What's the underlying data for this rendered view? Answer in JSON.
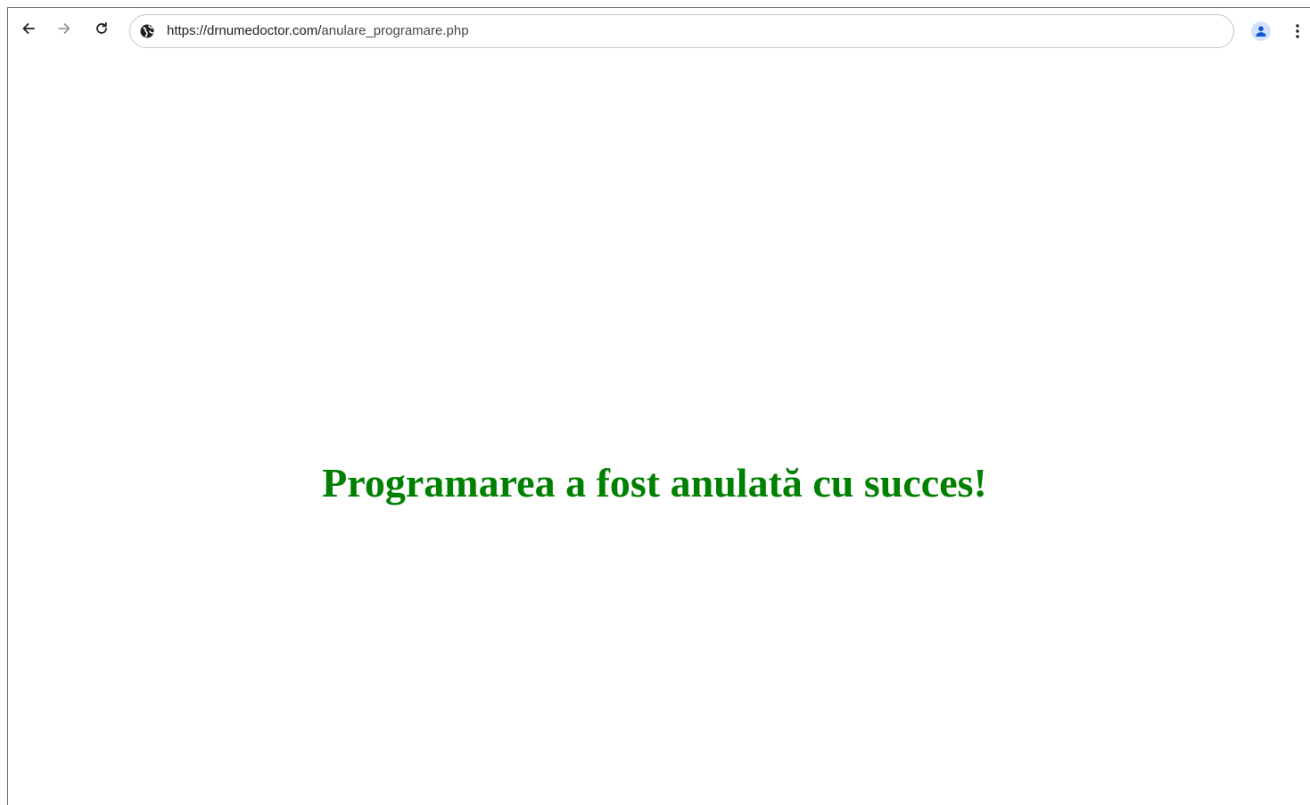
{
  "browser": {
    "url_host": "https://drnumedoctor.com/",
    "url_path": "anulare_programare.php",
    "icons": {
      "back": "arrow-left-icon",
      "forward": "arrow-right-icon",
      "reload": "reload-icon",
      "site": "globe-icon",
      "profile": "person-icon",
      "menu": "kebab-menu-icon"
    },
    "colors": {
      "accent": "#0b57d0",
      "profile_bg": "#d3e3fd"
    }
  },
  "page": {
    "message": "Programarea a fost anulată cu succes!",
    "message_color": "#008000"
  }
}
